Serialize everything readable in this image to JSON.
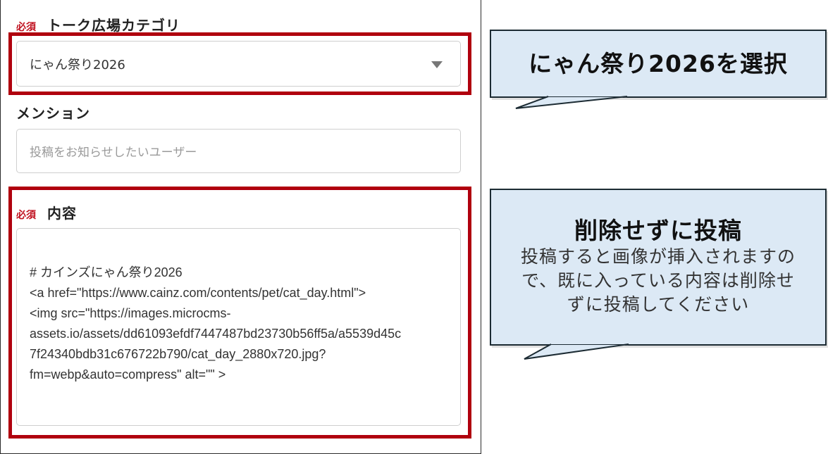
{
  "form": {
    "category": {
      "required_label": "必須",
      "label": "トーク広場カテゴリ",
      "selected_value": "にゃん祭り2026"
    },
    "mention": {
      "label": "メンション",
      "placeholder": "投稿をお知らせしたいユーザー"
    },
    "content": {
      "required_label": "必須",
      "label": "内容",
      "lines": [
        "# カインズにゃん祭り2026",
        "<a href=\"https://www.cainz.com/contents/pet/cat_day.html\">",
        "<img src=\"https://images.microcms-",
        "assets.io/assets/dd61093efdf7447487bd23730b56ff5a/a5539d45c",
        "7f24340bdb31c676722b790/cat_day_2880x720.jpg?",
        "fm=webp&auto=compress\" alt=\"\" >"
      ]
    }
  },
  "callouts": {
    "select": {
      "title": "にゃん祭り2026を選択"
    },
    "post": {
      "title": "削除せずに投稿",
      "body_lines": [
        "投稿すると画像が挿入されますの",
        "で、既に入っている内容は削除せ",
        "ずに投稿してください"
      ]
    }
  },
  "colors": {
    "highlight": "#b0000e",
    "required": "#c0101e",
    "callout_bg": "#dce9f5",
    "callout_border": "#1c2b33"
  }
}
